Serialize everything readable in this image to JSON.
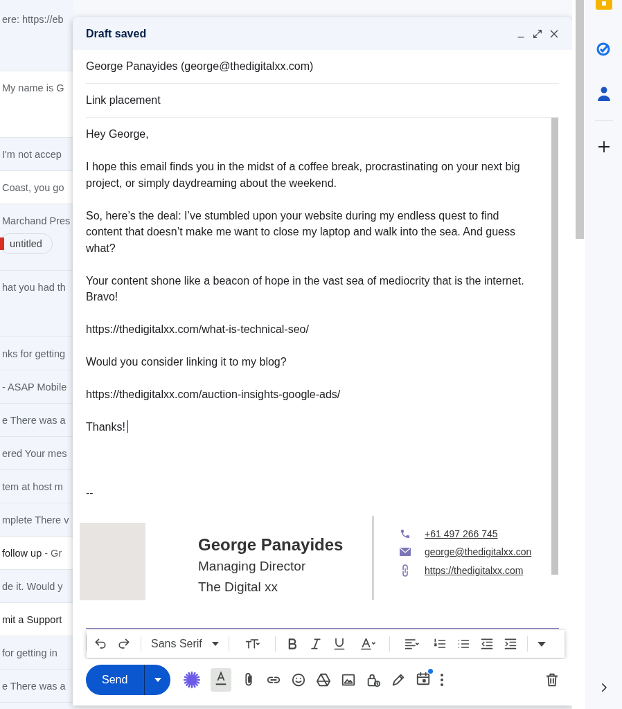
{
  "inbox_rows": [
    {
      "kind": "tall",
      "unread": false,
      "snippet": "ere: https://eb"
    },
    {
      "kind": "tall",
      "unread": true,
      "snippet": "My name is G"
    },
    {
      "kind": "normal",
      "unread": false,
      "snippet": "I'm not accep"
    },
    {
      "kind": "normal",
      "unread": true,
      "snippet": "Coast, you go"
    },
    {
      "kind": "tall",
      "unread": false,
      "snippet": "Marchand Pres",
      "chip": "untitled"
    },
    {
      "kind": "tall",
      "unread": false,
      "snippet": "hat you had th"
    },
    {
      "kind": "normal",
      "unread": false,
      "snippet": "nks for getting"
    },
    {
      "kind": "normal",
      "unread": false,
      "snippet": "- ASAP Mobile"
    },
    {
      "kind": "normal",
      "unread": false,
      "snippet": "e There was a"
    },
    {
      "kind": "normal",
      "unread": false,
      "snippet": "ered Your mes"
    },
    {
      "kind": "normal",
      "unread": false,
      "snippet": "tem at host m"
    },
    {
      "kind": "normal",
      "unread": false,
      "snippet": "mplete There v"
    },
    {
      "kind": "normal",
      "unread": true,
      "subject": "follow up",
      "snippet": "- Gr"
    },
    {
      "kind": "normal",
      "unread": false,
      "snippet": "de it. Would y"
    },
    {
      "kind": "normal",
      "unread": true,
      "subject": "mit a Support"
    },
    {
      "kind": "normal",
      "unread": false,
      "snippet": "for getting in"
    },
    {
      "kind": "normal",
      "unread": false,
      "snippet": "e There was a"
    }
  ],
  "compose": {
    "title": "Draft saved",
    "to": "George Panayides (george@thedigitalxx.com)",
    "subject": "Link placement",
    "body": {
      "paragraphs": [
        "Hey George,",
        "I hope this email finds you in the midst of a coffee break, procrastinating on your next big project, or simply daydreaming about the weekend.",
        "So, here’s the deal: I’ve stumbled upon your website during my endless quest to find content that doesn’t make me want to close my laptop and walk into the sea. And guess what?",
        "Your content shone like a beacon of hope in the vast sea of mediocrity that is the internet. Bravo!",
        "https://thedigitalxx.com/what-is-technical-seo/",
        "Would you consider linking it to my blog?",
        "https://thedigitalxx.com/auction-insights-google-ads/",
        "Thanks!"
      ],
      "caret": true
    },
    "signature": {
      "separator": "--",
      "name": "George Panayides",
      "role": "Managing Director",
      "company": "The Digital xx",
      "contacts": [
        {
          "kind": "phone",
          "text": "+61 497 266 745"
        },
        {
          "kind": "email",
          "text": "george@thedigitalxx.con"
        },
        {
          "kind": "web",
          "text": "https://thedigitalxx.com"
        }
      ]
    },
    "toolbar": {
      "font": "Sans Serif"
    },
    "send_label": "Send",
    "formatting_on": true,
    "schedule_badge": true
  }
}
